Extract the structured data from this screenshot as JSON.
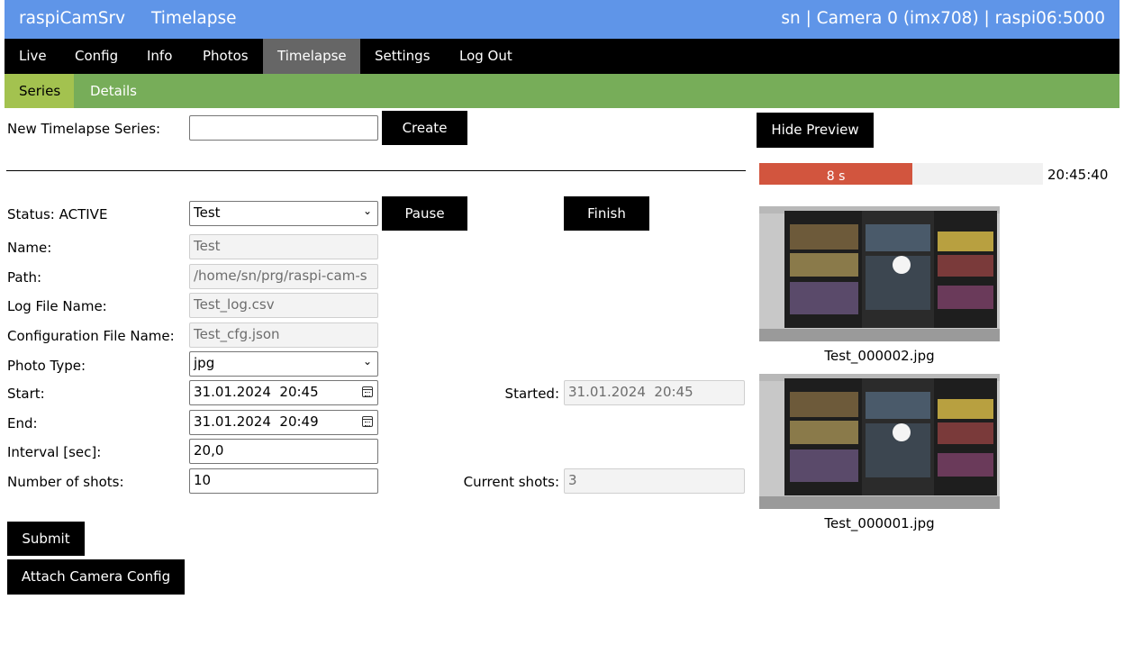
{
  "header": {
    "app_name": "raspiCamSrv",
    "page_name": "Timelapse",
    "info": "sn | Camera 0 (imx708) | raspi06:5000"
  },
  "nav": [
    "Live",
    "Config",
    "Info",
    "Photos",
    "Timelapse",
    "Settings",
    "Log Out"
  ],
  "subnav": [
    "Series",
    "Details"
  ],
  "new_series": {
    "label": "New Timelapse Series:",
    "value": "",
    "create_label": "Create"
  },
  "preview": {
    "hide_label": "Hide Preview",
    "countdown_label": "8 s",
    "countdown_fraction": 0.54,
    "time": "20:45:40",
    "images": [
      {
        "caption": "Test_000002.jpg"
      },
      {
        "caption": "Test_000001.jpg"
      }
    ]
  },
  "series": {
    "status_label": "Status: ACTIVE",
    "selected_series": "Test",
    "pause_label": "Pause",
    "finish_label": "Finish",
    "name_label": "Name:",
    "name_value": "Test",
    "path_label": "Path:",
    "path_value": "/home/sn/prg/raspi-cam-s",
    "log_label": "Log File Name:",
    "log_value": "Test_log.csv",
    "cfg_label": "Configuration File Name:",
    "cfg_value": "Test_cfg.json",
    "type_label": "Photo Type:",
    "type_value": "jpg",
    "start_label": "Start:",
    "start_value": "31.01.2024  20:45",
    "started_label": "Started:",
    "started_value": "31.01.2024  20:45",
    "end_label": "End:",
    "end_value": "31.01.2024  20:49",
    "interval_label": "Interval [sec]:",
    "interval_value": "20,0",
    "shots_label": "Number of shots:",
    "shots_value": "10",
    "current_label": "Current shots:",
    "current_value": "3",
    "submit_label": "Submit",
    "attach_label": "Attach Camera Config"
  }
}
